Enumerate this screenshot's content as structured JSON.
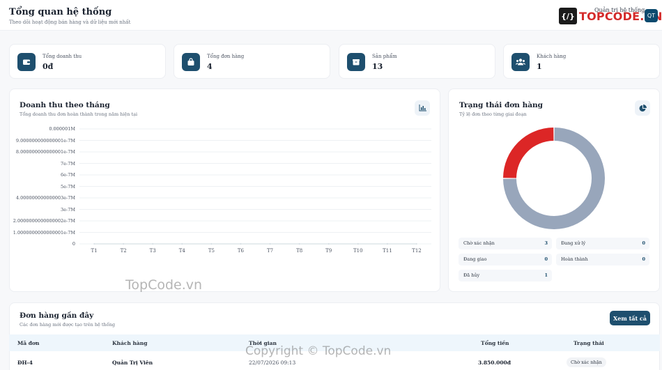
{
  "header": {
    "title": "Tổng quan hệ thống",
    "subtitle": "Theo dõi hoạt động bán hàng và dữ liệu mới nhất",
    "brand_mark": "{/}",
    "brand_name": "TOPCODE.VN",
    "admin_label": "Quản trị hệ thống",
    "avatar_initials": "QT"
  },
  "stats": [
    {
      "label": "Tổng doanh thu",
      "value": "0đ",
      "icon": "wallet-icon"
    },
    {
      "label": "Tổng đơn hàng",
      "value": "4",
      "icon": "shopping-bag-icon"
    },
    {
      "label": "Sản phẩm",
      "value": "13",
      "icon": "box-icon"
    },
    {
      "label": "Khách hàng",
      "value": "1",
      "icon": "users-icon"
    }
  ],
  "revenue_panel": {
    "title": "Doanh thu theo tháng",
    "subtitle": "Tổng doanh thu đơn hoàn thành trong năm hiện tại",
    "button_icon": "bar-chart-icon"
  },
  "order_status_panel": {
    "title": "Trạng thái đơn hàng",
    "subtitle": "Tỷ lệ đơn theo từng giai đoạn",
    "button_icon": "pie-chart-icon",
    "legend": [
      {
        "label": "Chờ xác nhận",
        "count": "3"
      },
      {
        "label": "Đang xử lý",
        "count": "0"
      },
      {
        "label": "Đang giao",
        "count": "0"
      },
      {
        "label": "Hoàn thành",
        "count": "0"
      },
      {
        "label": "Đã hủy",
        "count": "1"
      }
    ]
  },
  "chart_data": [
    {
      "type": "line",
      "categories": [
        "T1",
        "T2",
        "T3",
        "T4",
        "T5",
        "T6",
        "T7",
        "T8",
        "T9",
        "T10",
        "T11",
        "T12"
      ],
      "series": [
        {
          "values": [
            0,
            0,
            0,
            0,
            0,
            0,
            0,
            0,
            0,
            0,
            0,
            0
          ]
        }
      ],
      "y_tick_labels": [
        "0.000001M",
        "9.000000000000001e-7M",
        "8.000000000000001e-7M",
        "7e-7M",
        "6e-7M",
        "5e-7M",
        "4.000000000000003e-7M",
        "3e-7M",
        "2.0000000000000002e-7M",
        "1.0000000000000001e-7M",
        "0"
      ],
      "ylim": [
        0,
        1e-06
      ],
      "grid": true
    },
    {
      "type": "pie",
      "categories": [
        "Chờ xác nhận",
        "Đang xử lý",
        "Đang giao",
        "Hoàn thành",
        "Đã hủy"
      ],
      "values": [
        3,
        0,
        0,
        0,
        1
      ],
      "colors": [
        "#98a6bb",
        "#ef9a3a",
        "#3aa0ef",
        "#3fb96a",
        "#dc2626"
      ],
      "donut": true
    }
  ],
  "recent_orders": {
    "title": "Đơn hàng gần đây",
    "subtitle": "Các đơn hàng mới được tạo trên hệ thống",
    "view_all": "Xem tất cả",
    "columns": [
      "Mã đơn",
      "Khách hàng",
      "Thời gian",
      "Tổng tiền",
      "Trạng thái"
    ],
    "rows": [
      {
        "id": "ĐH-4",
        "customer": "Quản Trị Viên",
        "time": "22/07/2026 09:13",
        "total": "3.850.000đ",
        "status": "Chờ xác nhận"
      }
    ]
  },
  "watermarks": {
    "center": "TopCode.vn",
    "bottom": "Copyright © TopCode.vn"
  },
  "colors": {
    "accent": "#1e4f6e",
    "brand": "#d42a2a",
    "donut_main": "#98a6bb",
    "donut_cancel": "#dc2626"
  }
}
